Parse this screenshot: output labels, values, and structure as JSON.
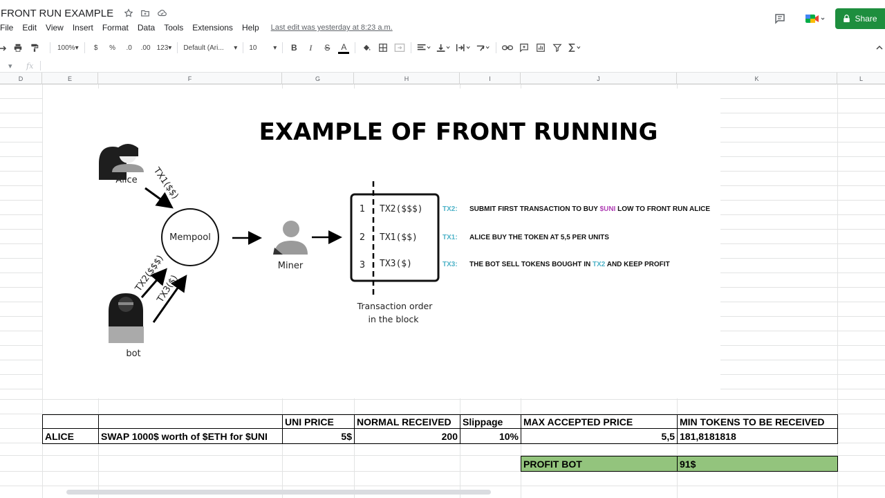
{
  "app": {
    "doc_title": "FRONT RUN EXAMPLE",
    "menu": [
      "File",
      "Edit",
      "View",
      "Insert",
      "Format",
      "Data",
      "Tools",
      "Extensions",
      "Help"
    ],
    "last_edit": "Last edit was yesterday at 8:23 a.m.",
    "share_label": "Share"
  },
  "toolbar": {
    "zoom": "100%",
    "currency": "$",
    "percent": "%",
    "dec_less": ".0",
    "dec_more": ".00",
    "number_format": "123",
    "font": "Default (Ari...",
    "font_size": "10",
    "bold": "B",
    "italic": "I",
    "strike": "S",
    "text_color": "A",
    "fx": "fx"
  },
  "columns": [
    "D",
    "E",
    "F",
    "G",
    "H",
    "I",
    "J",
    "K",
    "L"
  ],
  "infographic": {
    "title": "EXAMPLE OF FRONT RUNNING",
    "alice": "Alice",
    "bot": "bot",
    "mempool": "Mempool",
    "miner": "Miner",
    "tx1_arrow": "TX1($$)",
    "tx2_arrow": "TX2($$$)",
    "tx3_arrow": "TX3($)",
    "block_rows": [
      {
        "num": "1",
        "tx": "TX2($$$)"
      },
      {
        "num": "2",
        "tx": "TX1($$)"
      },
      {
        "num": "3",
        "tx": "TX3($)"
      }
    ],
    "block_caption_1": "Transaction order",
    "block_caption_2": "in the block",
    "notes": [
      {
        "tag": "TX2:",
        "pre": "SUBMIT FIRST TRANSACTION TO BUY ",
        "hl": "$UNI",
        "post": " LOW TO FRONT RUN ALICE"
      },
      {
        "tag": "TX1:",
        "pre": "ALICE BUY THE TOKEN AT 5,5 PER UNITS",
        "hl": "",
        "post": ""
      },
      {
        "tag": "TX3:",
        "pre": "THE BOT SELL TOKENS BOUGHT IN ",
        "hl": "TX2",
        "post": " AND KEEP PROFIT"
      }
    ],
    "colors": {
      "tag": "#4fb3c8",
      "uni": "#b03fb5"
    }
  },
  "table": {
    "headers": {
      "uni_price": "UNI PRICE",
      "normal_received": "NORMAL RECEIVED",
      "slippage": "Slippage",
      "max_price": "MAX ACCEPTED PRICE",
      "min_tokens": "MIN TOKENS TO BE RECEIVED"
    },
    "row": {
      "name": "ALICE",
      "desc": "SWAP 1000$ worth of $ETH for $UNI",
      "uni_price": "5$",
      "normal_received": "200",
      "slippage": "10%",
      "max_price": "5,5",
      "min_tokens": "181,8181818"
    },
    "profit_label": "PROFIT BOT",
    "profit_value": "91$",
    "profit_color": "#93c47d"
  }
}
